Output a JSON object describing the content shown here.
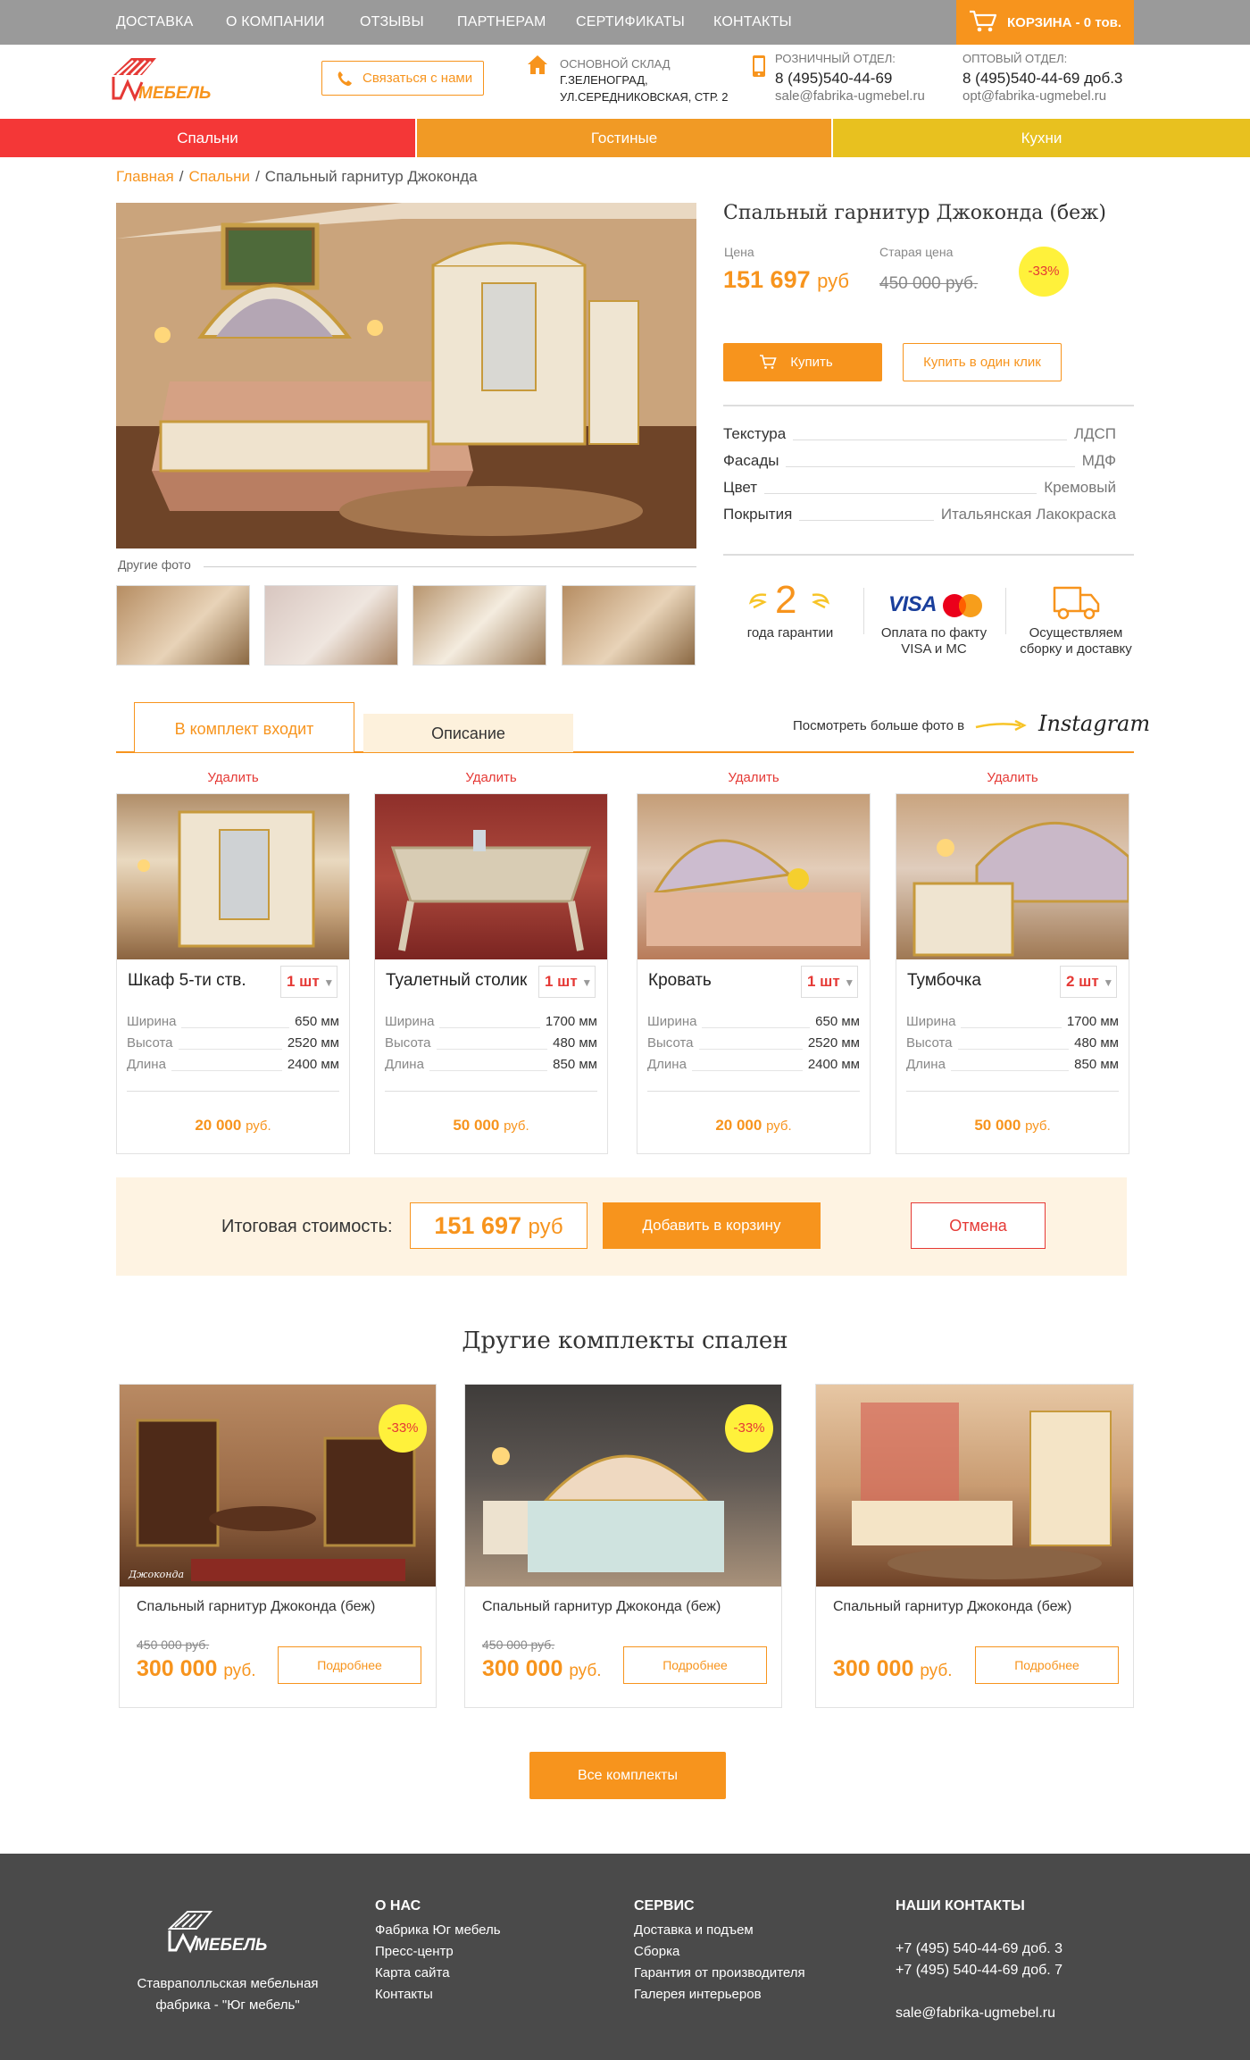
{
  "topnav": {
    "items": [
      "ДОСТАВКА",
      "О КОМПАНИИ",
      "ОТЗЫВЫ",
      "ПАРТНЕРАМ",
      "СЕРТИФИКАТЫ",
      "КОНТАКТЫ"
    ],
    "cart": "КОРЗИНА - 0 тов."
  },
  "header": {
    "logo_text": "МЕБЕЛЬ",
    "contact_button": "Связаться с нами",
    "warehouse_caption": "ОСНОВНОЙ СКЛАД",
    "warehouse_line1": "Г.ЗЕЛЕНОГРАД,",
    "warehouse_line2": "УЛ.СЕРЕДНИКОВСКАЯ, СТР. 2",
    "retail_caption": "РОЗНИЧНЫЙ ОТДЕЛ:",
    "retail_phone": "8 (495)540-44-69",
    "retail_email": "sale@fabrika-ugmebel.ru",
    "wholesale_caption": "ОПТОВЫЙ ОТДЕЛ:",
    "wholesale_phone": "8 (495)540-44-69 доб.3",
    "wholesale_email": "opt@fabrika-ugmebel.ru"
  },
  "categories": [
    {
      "label": "Спальни",
      "color": "#f43737"
    },
    {
      "label": "Гостиные",
      "color": "#f19a25"
    },
    {
      "label": "Кухни",
      "color": "#e8c11f"
    }
  ],
  "breadcrumb": {
    "home": "Главная",
    "section": "Спальни",
    "current": "Спальный гарнитур Джоконда"
  },
  "product": {
    "title": "Спальный гарнитур Джоконда (беж)",
    "price_label": "Цена",
    "price": "151 697",
    "price_currency": "руб",
    "old_price_label": "Старая цена",
    "old_price": "450 000 руб.",
    "discount": "-33%",
    "buy_button": "Купить",
    "one_click_button": "Купить в один клик",
    "other_photos": "Другие фото",
    "specs": [
      {
        "key": "Текстура",
        "value": "ЛДСП"
      },
      {
        "key": "Фасады",
        "value": "МДФ"
      },
      {
        "key": "Цвет",
        "value": "Кремовый"
      },
      {
        "key": "Покрытия",
        "value": "Итальянская Лакокраска"
      }
    ],
    "features": {
      "warranty_number": "2",
      "warranty_text": "года гарантии",
      "visa": "VISA",
      "payment_text_1": "Оплата по факту",
      "payment_text_2": "VISA и MC",
      "delivery_text_1": "Осуществляем",
      "delivery_text_2": "сборку и доставку"
    }
  },
  "tabs": {
    "active": "В комплект входит",
    "inactive": "Описание",
    "instagram_prompt": "Посмотреть больше фото в",
    "instagram": "Instagram"
  },
  "set_items": [
    {
      "delete": "Удалить",
      "name": "Шкаф 5-ти ств.",
      "qty": "1 шт",
      "specs": [
        {
          "k": "Ширина",
          "v": "650 мм"
        },
        {
          "k": "Высота",
          "v": "2520 мм"
        },
        {
          "k": "Длина",
          "v": "2400 мм"
        }
      ],
      "price": "20 000",
      "currency": "руб."
    },
    {
      "delete": "Удалить",
      "name": "Туалетный столик",
      "qty": "1 шт",
      "specs": [
        {
          "k": "Ширина",
          "v": "1700 мм"
        },
        {
          "k": "Высота",
          "v": "480 мм"
        },
        {
          "k": "Длина",
          "v": "850 мм"
        }
      ],
      "price": "50 000",
      "currency": "руб."
    },
    {
      "delete": "Удалить",
      "name": "Кровать",
      "qty": "1 шт",
      "specs": [
        {
          "k": "Ширина",
          "v": "650 мм"
        },
        {
          "k": "Высота",
          "v": "2520 мм"
        },
        {
          "k": "Длина",
          "v": "2400 мм"
        }
      ],
      "price": "20 000",
      "currency": "руб."
    },
    {
      "delete": "Удалить",
      "name": "Тумбочка",
      "qty": "2 шт",
      "specs": [
        {
          "k": "Ширина",
          "v": "1700 мм"
        },
        {
          "k": "Высота",
          "v": "480 мм"
        },
        {
          "k": "Длина",
          "v": "850 мм"
        }
      ],
      "price": "50 000",
      "currency": "руб."
    }
  ],
  "total": {
    "label": "Итоговая стоимость:",
    "value": "151 697",
    "currency": "руб",
    "add_button": "Добавить в корзину",
    "cancel_button": "Отмена"
  },
  "other_sets": {
    "title": "Другие комплекты спален",
    "items": [
      {
        "title": "Спальный гарнитур Джоконда (беж)",
        "old_price": "450 000 руб.",
        "price": "300 000",
        "currency": "руб.",
        "badge": "-33%",
        "button": "Подробнее",
        "watermark": "Джоконда"
      },
      {
        "title": "Спальный гарнитур Джоконда (беж)",
        "old_price": "450 000 руб.",
        "price": "300 000",
        "currency": "руб.",
        "badge": "-33%",
        "button": "Подробнее"
      },
      {
        "title": "Спальный гарнитур Джоконда (беж)",
        "price": "300 000",
        "currency": "руб.",
        "button": "Подробнее"
      }
    ],
    "all_button": "Все комплекты"
  },
  "footer": {
    "logo_text": "МЕБЕЛЬ",
    "description_1": "Ставраполльская мебельная",
    "description_2": "фабрика - \"Юг мебель\"",
    "about_title": "О НАС",
    "about_items": [
      "Фабрика Юг мебель",
      "Пресс-центр",
      "Карта сайта",
      "Контакты"
    ],
    "service_title": "СЕРВИС",
    "service_items": [
      "Доставка и подъем",
      "Сборка",
      "Гарантия от производителя",
      "Галерея интерьеров"
    ],
    "contacts_title": "НАШИ КОНТАКТЫ",
    "contact_phone_1": "+7 (495) 540-44-69 доб. 3",
    "contact_phone_2": "+7 (495) 540-44-69 доб. 7",
    "contact_email": "sale@fabrika-ugmebel.ru"
  },
  "colors": {
    "accent": "#f7941d",
    "topbar": "#9a9a9a",
    "discount_badge": "#fff13b",
    "danger": "#e53935",
    "footer": "#4a4a4a"
  }
}
